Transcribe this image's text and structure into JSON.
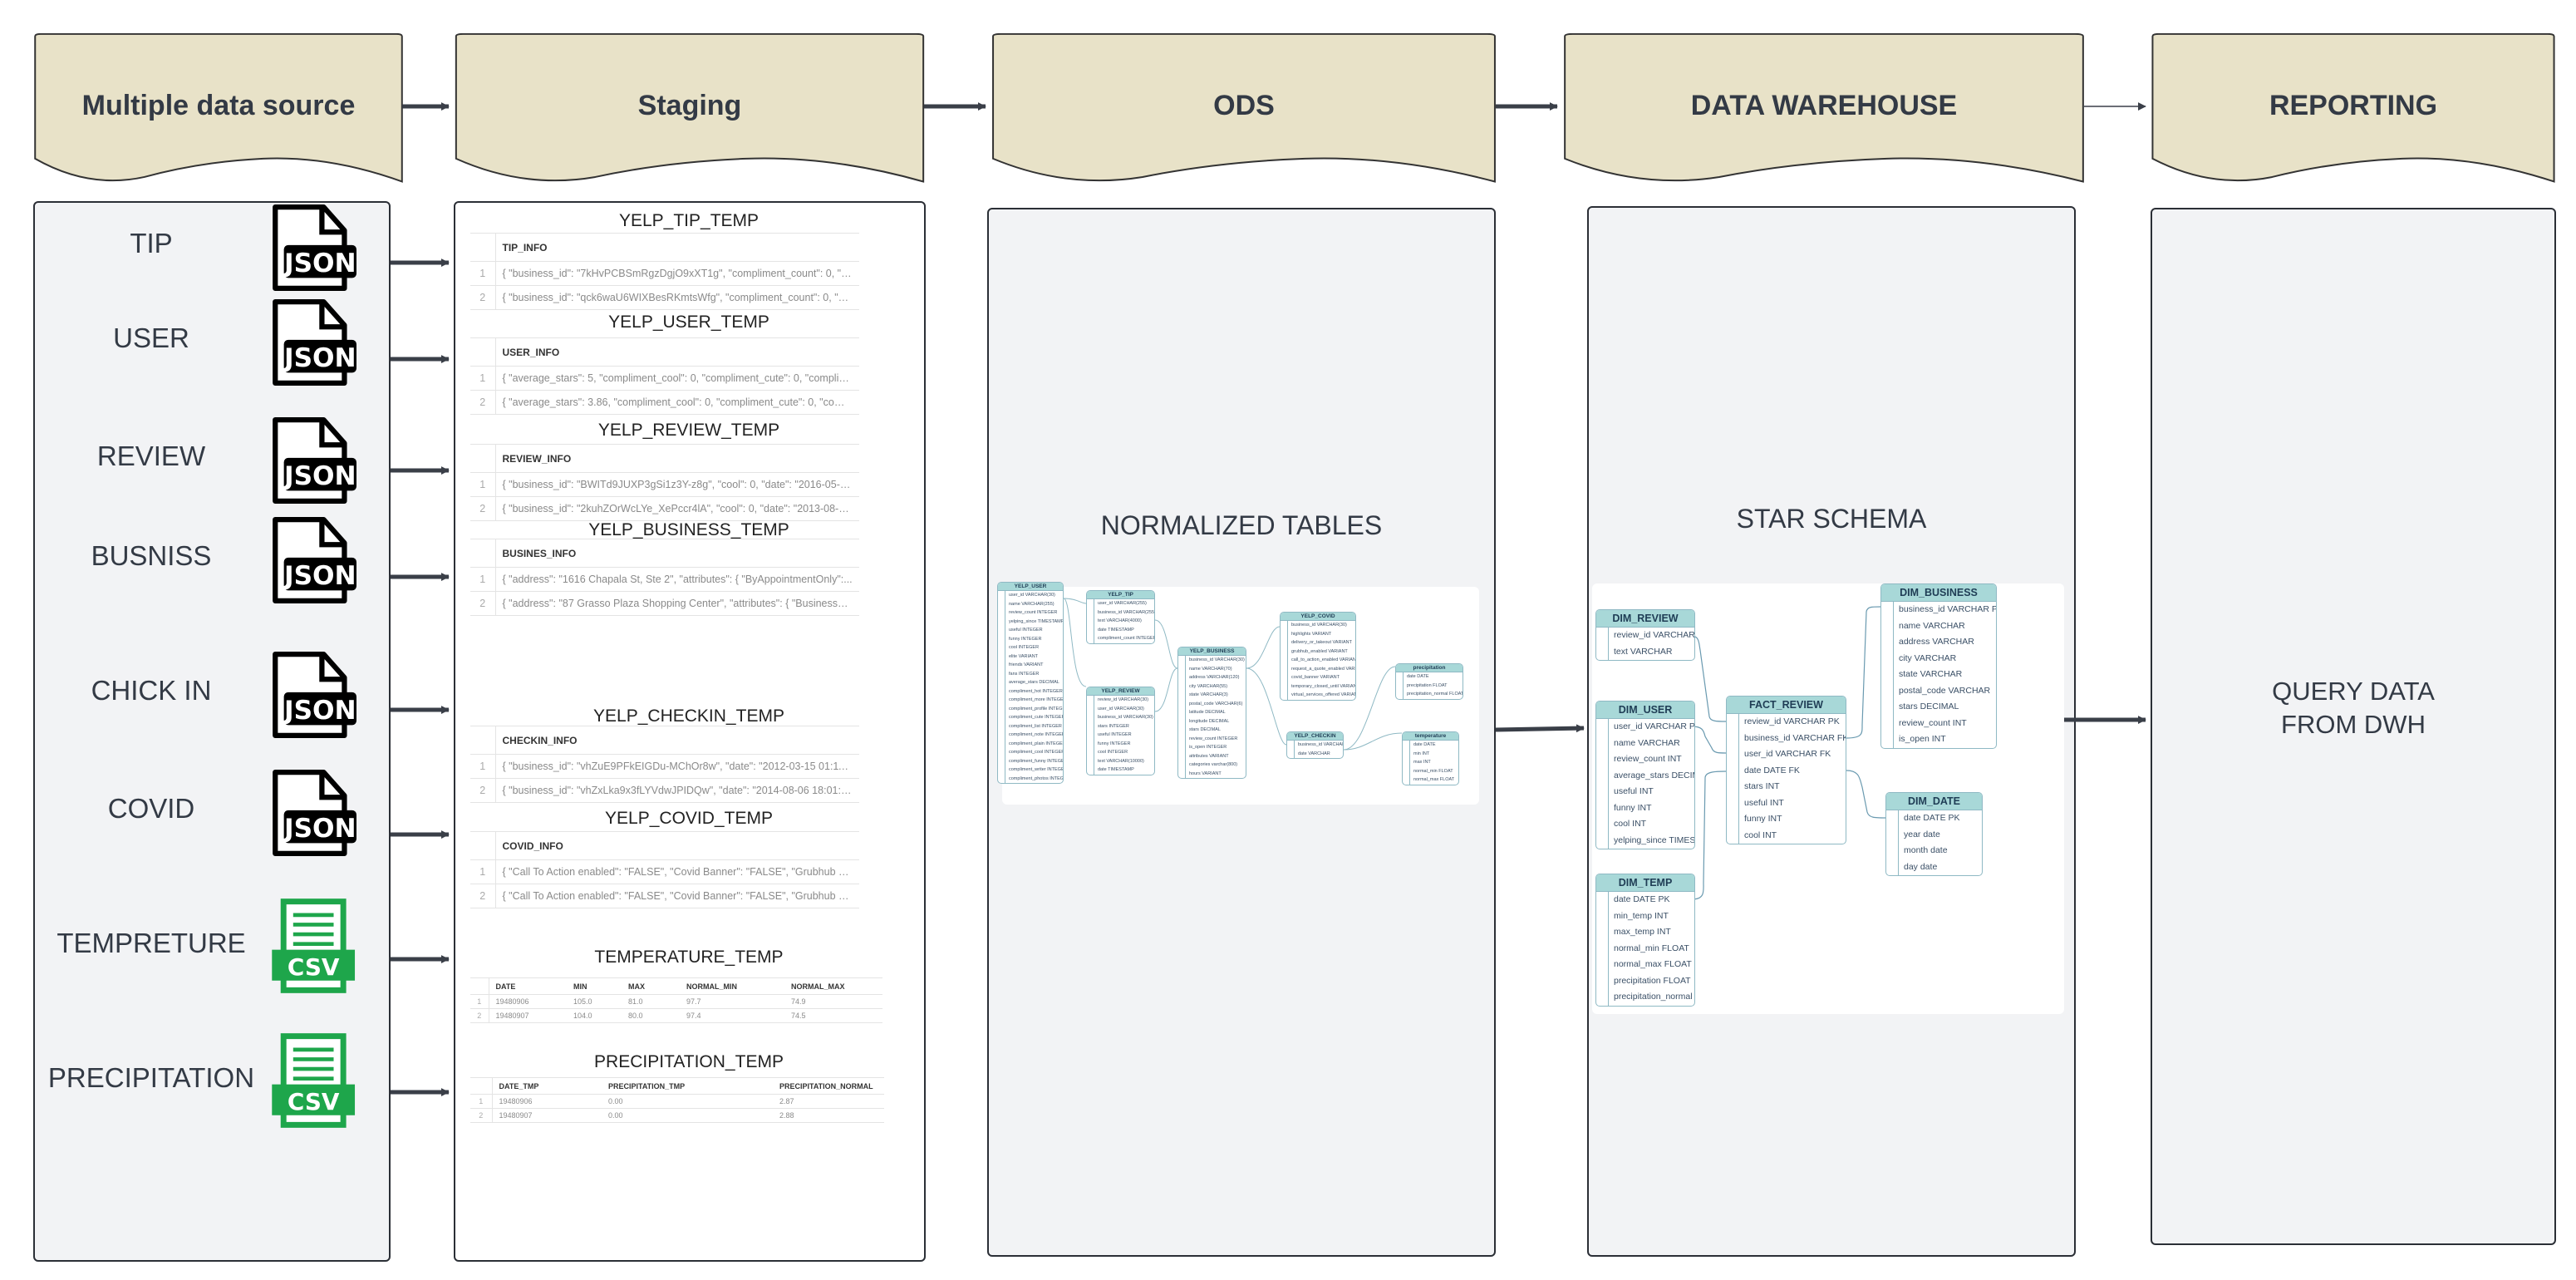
{
  "headers": [
    "Multiple data source",
    "Staging",
    "ODS",
    "DATA WAREHOUSE",
    "REPORTING"
  ],
  "colors": {
    "header_fill": "#e8e2c8",
    "panel_gray": "#f2f3f5",
    "table_header": "#a8d8d8",
    "csv_green": "#1ea64b",
    "arrow": "#3a3f48"
  },
  "sources": [
    {
      "label": "TIP",
      "icon": "json-file-icon",
      "badge": "JSON"
    },
    {
      "label": "USER",
      "icon": "json-file-icon",
      "badge": "JSON"
    },
    {
      "label": "REVIEW",
      "icon": "json-file-icon",
      "badge": "JSON"
    },
    {
      "label": "BUSNISS",
      "icon": "json-file-icon",
      "badge": "JSON"
    },
    {
      "label": "CHICK IN",
      "icon": "json-file-icon",
      "badge": "JSON"
    },
    {
      "label": "COVID",
      "icon": "json-file-icon",
      "badge": "JSON"
    },
    {
      "label": "TEMPRETURE",
      "icon": "csv-file-icon",
      "badge": "CSV"
    },
    {
      "label": "PRECIPITATION",
      "icon": "csv-file-icon",
      "badge": "CSV"
    }
  ],
  "staging": [
    {
      "title": "YELP_TIP_TEMP",
      "columns": [
        "TIP_INFO"
      ],
      "rows": [
        [
          "1",
          "{   \"business_id\": \"7kHvPCBSmRgzDgjO9xXT1g\",   \"compliment_count\": 0,   \"date..."
        ],
        [
          "2",
          "{   \"business_id\": \"qck6waU6WIXBesRKmtsWfg\",   \"compliment_count\": 0,   \"date..."
        ]
      ]
    },
    {
      "title": "YELP_USER_TEMP",
      "columns": [
        "USER_INFO"
      ],
      "rows": [
        [
          "1",
          "{   \"average_stars\": 5,   \"compliment_cool\": 0,   \"compliment_cute\": 0,   \"complime..."
        ],
        [
          "2",
          "{   \"average_stars\": 3.86,   \"compliment_cool\": 0,   \"compliment_cute\": 0,   \"compli..."
        ]
      ]
    },
    {
      "title": "YELP_REVIEW_TEMP",
      "columns": [
        "REVIEW_INFO"
      ],
      "rows": [
        [
          "1",
          "{   \"business_id\": \"BWITd9JUXP3gSi1z3Y-z8g\",   \"cool\": 0,   \"date\": \"2016-05-20..."
        ],
        [
          "2",
          "{   \"business_id\": \"2kuhZOrWcLYe_XePccr4lA\",   \"cool\": 0,   \"date\": \"2013-08-18..."
        ]
      ]
    },
    {
      "title": "YELP_BUSINESS_TEMP",
      "columns": [
        "BUSINES_INFO"
      ],
      "rows": [
        [
          "1",
          "{   \"address\": \"1616 Chapala St, Ste 2\",   \"attributes\": {     \"ByAppointmentOnly\":..."
        ],
        [
          "2",
          "{   \"address\": \"87 Grasso Plaza Shopping Center\",   \"attributes\": {     \"BusinessAcc..."
        ]
      ]
    },
    {
      "title": "YELP_CHECKIN_TEMP",
      "columns": [
        "CHECKIN_INFO"
      ],
      "rows": [
        [
          "1",
          "{   \"business_id\": \"vhZuE9PFkEIGDu-MChOr8w\",   \"date\": \"2012-03-15 01:11:21..."
        ],
        [
          "2",
          "{   \"business_id\": \"vhZxLka9x3fLYVdwJPIDQw\",   \"date\": \"2014-08-06 18:01:06,..."
        ]
      ]
    },
    {
      "title": "YELP_COVID_TEMP",
      "columns": [
        "COVID_INFO"
      ],
      "rows": [
        [
          "1",
          "{   \"Call To Action enabled\": \"FALSE\",   \"Covid Banner\": \"FALSE\",   \"Grubhub enable..."
        ],
        [
          "2",
          "{   \"Call To Action enabled\": \"FALSE\",   \"Covid Banner\": \"FALSE\",   \"Grubhub enable..."
        ]
      ]
    },
    {
      "title": "TEMPERATURE_TEMP",
      "columns": [
        "DATE",
        "MIN",
        "MAX",
        "NORMAL_MIN",
        "NORMAL_MAX"
      ],
      "rows": [
        [
          "1",
          "19480906",
          "105.0",
          "81.0",
          "97.7",
          "74.9"
        ],
        [
          "2",
          "19480907",
          "104.0",
          "80.0",
          "97.4",
          "74.5"
        ]
      ]
    },
    {
      "title": "PRECIPITATION_TEMP",
      "columns": [
        "DATE_TMP",
        "PRECIPITATION_TMP",
        "PRECIPITATION_NORMAL"
      ],
      "rows": [
        [
          "1",
          "19480906",
          "0.00",
          "2.87"
        ],
        [
          "2",
          "19480907",
          "0.00",
          "2.88"
        ]
      ]
    }
  ],
  "ods": {
    "label": "NORMALIZED TABLES",
    "tables": [
      {
        "name": "YELP_USER",
        "columns": [
          "user_id VARCHAR(30)",
          "name VARCHAR(255)",
          "review_count INTEGER",
          "yelping_since TIMESTAMP",
          "useful INTEGER",
          "funny INTEGER",
          "cool INTEGER",
          "elite VARIANT",
          "friends VARIANT",
          "fans INTEGER",
          "average_stars DECIMAL",
          "compliment_hot INTEGER",
          "compliment_more INTEGER",
          "compliment_profile INTEGER",
          "compliment_cute INTEGER",
          "compliment_list INTEGER",
          "compliment_note INTEGER",
          "compliment_plain INTEGER",
          "compliment_cool INTEGER",
          "compliment_funny INTEGER",
          "compliment_writer INTEGER",
          "compliment_photos INTEGER"
        ]
      },
      {
        "name": "YELP_TIP",
        "columns": [
          "user_id VARCHAR(255)",
          "business_id VARCHAR(255)",
          "text VARCHAR(4000)",
          "date TIMESTAMP",
          "compliment_count INTEGER"
        ]
      },
      {
        "name": "YELP_REVIEW",
        "columns": [
          "review_id VARCHAR(30)",
          "user_id VARCHAR(30)",
          "business_id VARCHAR(30)",
          "stars INTEGER",
          "useful INTEGER",
          "funny INTEGER",
          "cool INTEGER",
          "text VARCHAR(10000)",
          "date TIMESTAMP"
        ]
      },
      {
        "name": "YELP_BUSINESS",
        "columns": [
          "business_id VARCHAR(30)",
          "name VARCHAR(70)",
          "address VARCHAR(120)",
          "city VARCHAR(55)",
          "state VARCHAR(3)",
          "postal_code VARCHAR(6)",
          "latitude DECIMAL",
          "longitude DECIMAL",
          "stars DECIMAL",
          "review_count INTEGER",
          "is_open INTEGER",
          "attributes VARIANT",
          "categories varchar(800)",
          "hours VARIANT"
        ]
      },
      {
        "name": "YELP_COVID",
        "columns": [
          "business_id VARCHAR(30)",
          "highlights VARIANT",
          "delivery_or_takeout VARIANT",
          "grubhub_enabled VARIANT",
          "call_to_action_enabled VARIANT",
          "request_a_quote_enabled VARIANT",
          "covid_banner VARIANT",
          "temporary_closed_until VARIANT",
          "virtual_services_offered VARIANT"
        ]
      },
      {
        "name": "YELP_CHECKIN",
        "columns": [
          "business_id VARCHAR(30)",
          "date VARCHAR"
        ]
      },
      {
        "name": "precipitation",
        "columns": [
          "date DATE",
          "precipitation FLOAT",
          "precipitation_normal FLOAT"
        ]
      },
      {
        "name": "temperature",
        "columns": [
          "date DATE",
          "min INT",
          "max INT",
          "normal_min FLOAT",
          "normal_max FLOAT"
        ]
      }
    ]
  },
  "dwh": {
    "label": "STAR SCHEMA",
    "tables": [
      {
        "name": "DIM_REVIEW",
        "columns": [
          "review_id VARCHAR PK",
          "text VARCHAR"
        ]
      },
      {
        "name": "DIM_USER",
        "columns": [
          "user_id VARCHAR PK",
          "name VARCHAR",
          "review_count INT",
          "average_stars DECIMAL",
          "useful INT",
          "funny INT",
          "cool INT",
          "yelping_since TIMESTAMP"
        ]
      },
      {
        "name": "DIM_TEMP",
        "columns": [
          "date DATE PK",
          "min_temp INT",
          "max_temp INT",
          "normal_min FLOAT",
          "normal_max FLOAT",
          "precipitation FLOAT",
          "precipitation_normal FLOAT"
        ]
      },
      {
        "name": "FACT_REVIEW",
        "columns": [
          "review_id VARCHAR PK",
          "business_id VARCHAR FK",
          "user_id VARCHAR FK",
          "date DATE FK",
          "stars INT",
          "useful INT",
          "funny INT",
          "cool INT"
        ]
      },
      {
        "name": "DIM_BUSINESS",
        "columns": [
          "business_id VARCHAR PK",
          "name VARCHAR",
          "address VARCHAR",
          "city VARCHAR",
          "state VARCHAR",
          "postal_code VARCHAR",
          "stars DECIMAL",
          "review_count INT",
          "is_open INT"
        ]
      },
      {
        "name": "DIM_DATE",
        "columns": [
          "date DATE PK",
          "year date",
          "month date",
          "day date"
        ]
      }
    ]
  },
  "reporting": {
    "label_line1": "QUERY DATA",
    "label_line2": "FROM DWH"
  }
}
